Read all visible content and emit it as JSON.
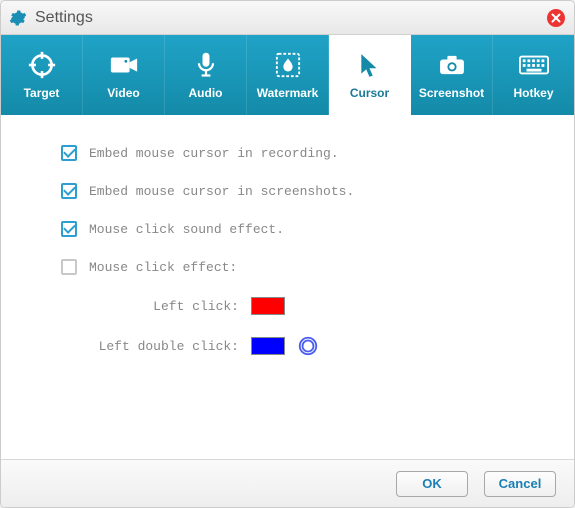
{
  "window": {
    "title": "Settings"
  },
  "tabs": {
    "target": "Target",
    "video": "Video",
    "audio": "Audio",
    "watermark": "Watermark",
    "cursor": "Cursor",
    "screenshot": "Screenshot",
    "hotkey": "Hotkey",
    "active": "cursor"
  },
  "options": {
    "embed_recording": {
      "label": "Embed mouse cursor in recording.",
      "checked": true
    },
    "embed_screenshots": {
      "label": "Embed mouse cursor in screenshots.",
      "checked": true
    },
    "click_sound": {
      "label": "Mouse click sound effect.",
      "checked": true
    },
    "click_effect": {
      "label": "Mouse click effect:",
      "checked": false
    },
    "left_click": {
      "label": "Left click:",
      "color": "#ff0000"
    },
    "left_double_click": {
      "label": "Left double click:",
      "color": "#0000ff"
    }
  },
  "footer": {
    "ok": "OK",
    "cancel": "Cancel"
  },
  "colors": {
    "accent": "#158aa8",
    "ring": "#4a5df0"
  }
}
